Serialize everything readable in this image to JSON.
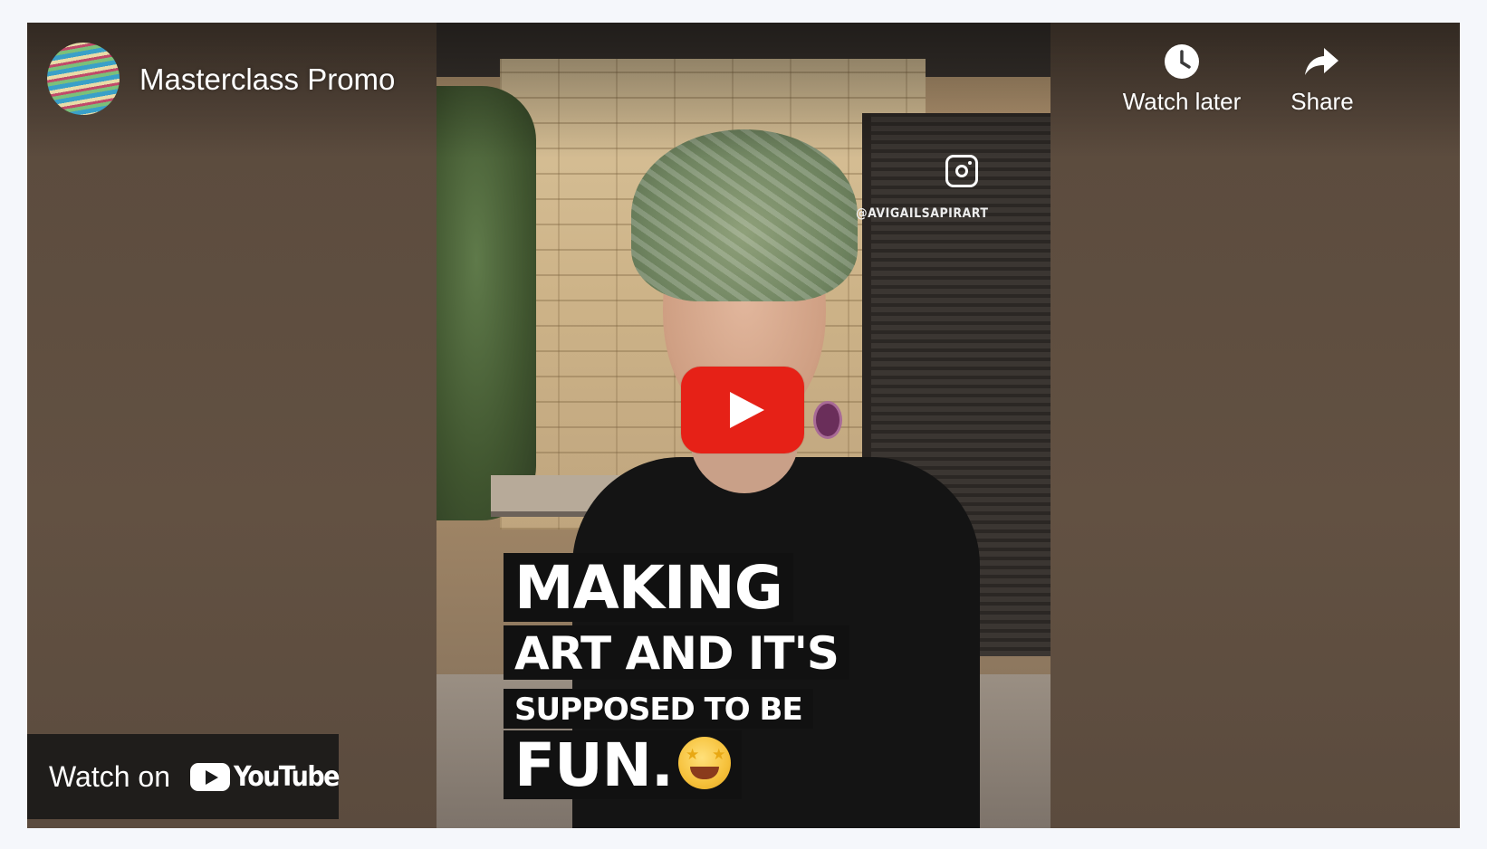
{
  "video": {
    "title": "Masterclass Promo",
    "instagram_handle": "@AVIGAILSAPIRART",
    "captions": [
      "MAKING",
      "ART AND IT'S",
      "SUPPOSED TO BE",
      "FUN."
    ]
  },
  "controls": {
    "watch_later_label": "Watch later",
    "share_label": "Share"
  },
  "watch_on": {
    "label": "Watch on",
    "brand": "YouTube"
  },
  "colors": {
    "play_button": "#e62117",
    "background": "#f5f7fb"
  }
}
